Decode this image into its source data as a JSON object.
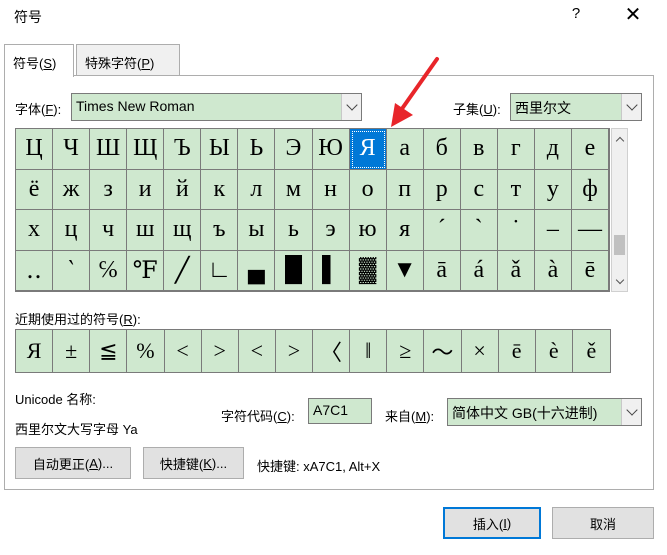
{
  "window": {
    "title": "符号",
    "help": "?",
    "close": "✕"
  },
  "tabs": [
    {
      "label": "符号(",
      "key": "S",
      "tail": ")"
    },
    {
      "label": "特殊字符(",
      "key": "P",
      "tail": ")"
    }
  ],
  "font": {
    "label": "字体(",
    "key": "F",
    "tail": "):",
    "value": "Times New Roman"
  },
  "subset": {
    "label": "子集(",
    "key": "U",
    "tail": "):",
    "value": "西里尔文"
  },
  "symbols": [
    "Ц",
    "Ч",
    "Ш",
    "Щ",
    "Ъ",
    "Ы",
    "Ь",
    "Э",
    "Ю",
    "Я",
    "а",
    "б",
    "в",
    "г",
    "д",
    "е",
    "ё",
    "ж",
    "з",
    "и",
    "й",
    "к",
    "л",
    "м",
    "н",
    "о",
    "п",
    "р",
    "с",
    "т",
    "у",
    "ф",
    "х",
    "ц",
    "ч",
    "ш",
    "щ",
    "ъ",
    "ы",
    "ь",
    "э",
    "ю",
    "я",
    "ˊ",
    "ˋ",
    "˙",
    "–",
    "—",
    "‥",
    "‵",
    "℅",
    "℉",
    "╱",
    "∟",
    "▄",
    "█",
    "▌",
    "▓",
    "▼",
    "ā",
    "á",
    "ǎ",
    "à",
    "ē"
  ],
  "selected_symbol_index": 9,
  "recent": {
    "label": "近期使用过的符号(",
    "key": "R",
    "tail": "):",
    "items": [
      "Я",
      "±",
      "≦",
      "%",
      "<",
      ">",
      "<",
      ">",
      "〈",
      "‖",
      "≥",
      "～",
      "×",
      "ē",
      "è",
      "ě"
    ]
  },
  "unicode": {
    "label": "Unicode 名称:",
    "name": "西里尔文大写字母 Ya"
  },
  "charcode": {
    "label": "字符代码(",
    "key": "C",
    "tail": "):",
    "value": "A7C1"
  },
  "from": {
    "label": "来自(",
    "key": "M",
    "tail": "):",
    "value": "简体中文 GB(十六进制)"
  },
  "autocorrect": {
    "label": "自动更正(",
    "key": "A",
    "tail": ")..."
  },
  "hotkey": {
    "label": "快捷键(",
    "key": "K",
    "tail": ")..."
  },
  "shortcut_text": "快捷键: xA7C1, Alt+X",
  "insert": {
    "label": "插入(",
    "key": "I",
    "tail": ")"
  },
  "cancel": {
    "label": "取消"
  },
  "colors": {
    "cell_bg": "#cfe8cf",
    "selected": "#0078d7",
    "arrow": "#e8252a"
  }
}
